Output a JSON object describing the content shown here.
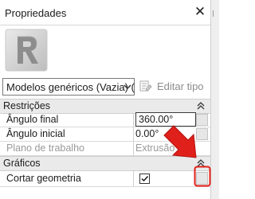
{
  "panel": {
    "title": "Propriedades",
    "close_label": "✕"
  },
  "type_selector": {
    "selected": "Modelos genéricos (Vazia) (",
    "edit_type_label": "Editar tipo"
  },
  "sections": [
    {
      "label": "Restrições",
      "rows": [
        {
          "name": "Ângulo final",
          "value": "360.00°",
          "editing": true
        },
        {
          "name": "Ângulo inicial",
          "value": "0.00°",
          "editing": false
        },
        {
          "name": "Plano de trabalho",
          "value": "Extrusão",
          "disabled": true
        }
      ]
    },
    {
      "label": "Gráficos",
      "rows": [
        {
          "name": "Cortar geometria",
          "value": "checked"
        }
      ]
    }
  ],
  "colors": {
    "annotation_red": "#e0201a"
  }
}
